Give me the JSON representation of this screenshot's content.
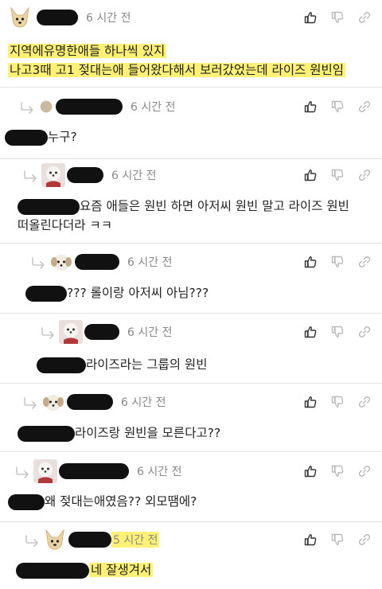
{
  "comments": [
    {
      "time": "6 시간 전",
      "lines": [
        "지역에유명한애들 하나씩 있지",
        "나고3때 고1 젖대는애 들어왔다해서 보러갔었는데 라이즈 원빈임"
      ]
    },
    {
      "time": "6 시간 전",
      "lines": [
        "누구?"
      ]
    },
    {
      "time": "6 시간 전",
      "lines": [
        "요즘 애들은 원빈 하면 아저씨 원빈 말고 라이즈 원빈",
        "떠올린다더라 ㅋㅋ"
      ]
    },
    {
      "time": "6 시간 전",
      "lines": [
        "??? 롤이랑 아저씨 아님???"
      ]
    },
    {
      "time": "6 시간 전",
      "lines": [
        "라이즈라는 그룹의 원빈"
      ]
    },
    {
      "time": "6 시간 전",
      "lines": [
        "라이즈랑 원빈을 모른다고??"
      ]
    },
    {
      "time": "6 시간 전",
      "lines": [
        "왜 젖대는애였음?? 외모땜에?"
      ]
    },
    {
      "time": "5 시간 전",
      "lines": [
        "네 잘생겨서"
      ]
    }
  ],
  "icons": {
    "like": "thumb-up-icon",
    "dislike": "thumb-down-icon",
    "link": "link-icon",
    "reply": "reply-arrow-icon"
  },
  "colors": {
    "highlight": "#fff176",
    "redaction": "#111111",
    "meta": "#888888"
  }
}
